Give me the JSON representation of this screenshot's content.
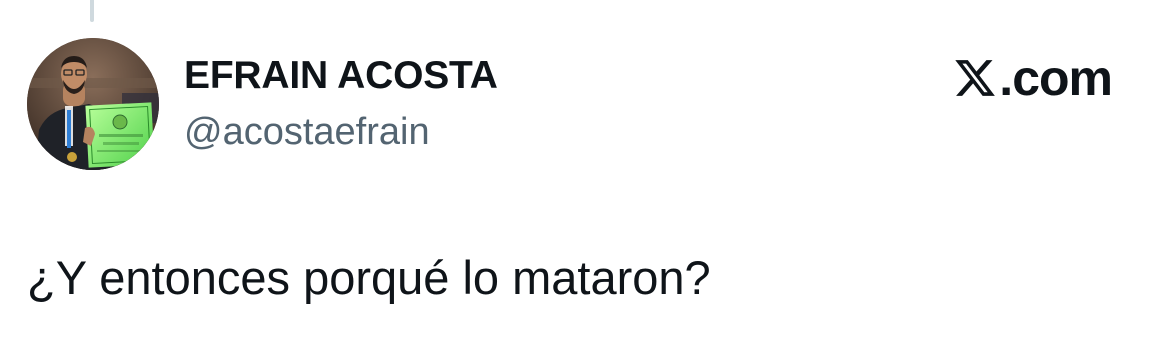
{
  "tweet": {
    "author": {
      "display_name": "EFRAIN ACOSTA",
      "handle": "@acostaefrain",
      "avatar_icon": "profile-photo"
    },
    "brand": {
      "logo_icon": "x-logo-icon",
      "label": ".com"
    },
    "text": "¿Y entonces porqué lo mataron?"
  },
  "colors": {
    "text": "#0f1419",
    "secondary_text": "#536471",
    "thread_line": "#cfd9de",
    "background": "#ffffff"
  }
}
